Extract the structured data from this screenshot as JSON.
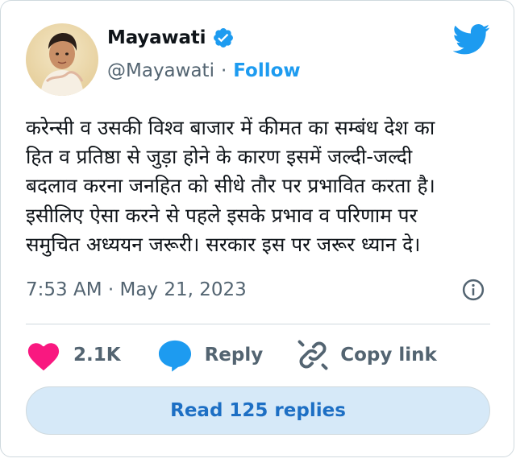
{
  "author": {
    "name": "Mayawati",
    "handle": "@Mayawati",
    "separator": "·",
    "follow_label": "Follow"
  },
  "icons": {
    "verified": "verified-badge-icon",
    "brand": "twitter-bird-icon",
    "info": "info-icon",
    "like": "heart-icon",
    "reply": "speech-bubble-icon",
    "copy": "link-icon"
  },
  "colors": {
    "accent": "#1d9bf0",
    "like": "#f91880",
    "muted": "#536471",
    "button_bg": "#d6e9f8"
  },
  "tweet": {
    "text": "करेन्सी व उसकी विश्व बाजार में कीमत का सम्बंध देश का\nहित व प्रतिष्ठा से जुड़ा होने के कारण इसमें जल्दी-जल्दी\nबदलाव करना जनहित को सीधे तौर पर प्रभावित करता है।\nइसीलिए ऐसा करने से पहले इसके प्रभाव व परिणाम पर\nसमुचित अध्ययन जरूरी। सरकार इस पर जरूर ध्यान दे।",
    "timestamp": "7:53 AM · May 21, 2023"
  },
  "actions": {
    "like_count": "2.1K",
    "reply_label": "Reply",
    "copy_link_label": "Copy link"
  },
  "footer": {
    "read_replies_label": "Read 125 replies"
  }
}
